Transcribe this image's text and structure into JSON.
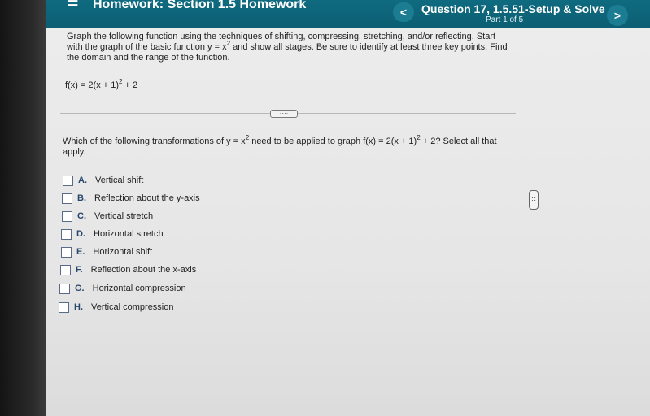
{
  "header": {
    "homework_title": "Homework: Section 1.5 Homework",
    "question_title": "Question 17, 1.5.51-Setup & Solve",
    "part_label": "Part 1 of 5",
    "prev_symbol": "<",
    "next_symbol": ">"
  },
  "problem": {
    "instructions_a": "Graph the following function using the techniques of shifting, compressing, stretching, and/or reflecting. Start with the graph of the basic function y = x",
    "instructions_exp": "2",
    "instructions_b": " and show all stages. Be sure to identify at least three key points. Find the domain and the range of the function.",
    "function_a": "f(x) = 2(x + 1)",
    "function_exp": "2",
    "function_b": " + 2"
  },
  "divider": {
    "more_label": "····"
  },
  "question": {
    "text_a": "Which of the following transformations of y = x",
    "text_exp1": "2",
    "text_b": " need to be applied to graph f(x) = 2(x + 1)",
    "text_exp2": "2",
    "text_c": " + 2? Select all that apply."
  },
  "options": [
    {
      "letter": "A.",
      "label": "Vertical shift",
      "checked": false
    },
    {
      "letter": "B.",
      "label": "Reflection about the y-axis",
      "checked": false
    },
    {
      "letter": "C.",
      "label": "Vertical stretch",
      "checked": false
    },
    {
      "letter": "D.",
      "label": "Horizontal stretch",
      "checked": false
    },
    {
      "letter": "E.",
      "label": "Horizontal shift",
      "checked": false
    },
    {
      "letter": "F.",
      "label": "Reflection about the x-axis",
      "checked": false
    },
    {
      "letter": "G.",
      "label": "Horizontal compression",
      "checked": false
    },
    {
      "letter": "H.",
      "label": "Vertical compression",
      "checked": false
    }
  ],
  "scroll": {
    "handle_label": "∷"
  },
  "colors": {
    "header_bg": "#0d6478",
    "option_letter": "#27466b",
    "page_bg": "#e8e8e8"
  }
}
